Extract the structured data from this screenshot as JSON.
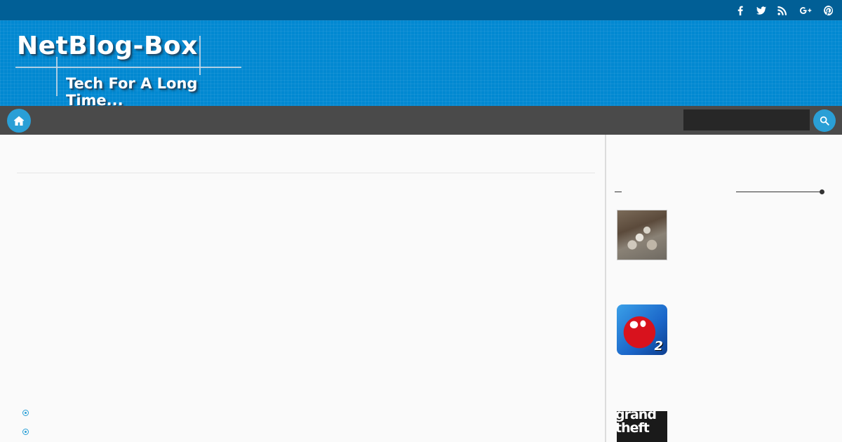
{
  "site": {
    "title": "NetBlog-Box",
    "tagline": "Tech For A Long Time..."
  },
  "social": {
    "icons": [
      "facebook-icon",
      "twitter-icon",
      "rss-icon",
      "google-plus-icon",
      "pinterest-icon"
    ]
  },
  "nav": {
    "home_icon": "home-icon",
    "search_icon": "search-icon",
    "search_value": ""
  },
  "sidebar": {
    "posts": [
      {
        "thumbnail_icon": "money-pile-thumbnail"
      },
      {
        "thumbnail_icon": "spiderman-thumbnail",
        "badge": "2"
      },
      {
        "thumbnail_icon": "gta-thumbnail",
        "thumbnail_text": "grand theft"
      }
    ]
  },
  "colors": {
    "topbar": "#015f96",
    "header": "#0288d1",
    "navbar": "#4a4a4a",
    "accent": "#2a9fd6",
    "search_field": "#272727",
    "background": "#fafafa"
  }
}
